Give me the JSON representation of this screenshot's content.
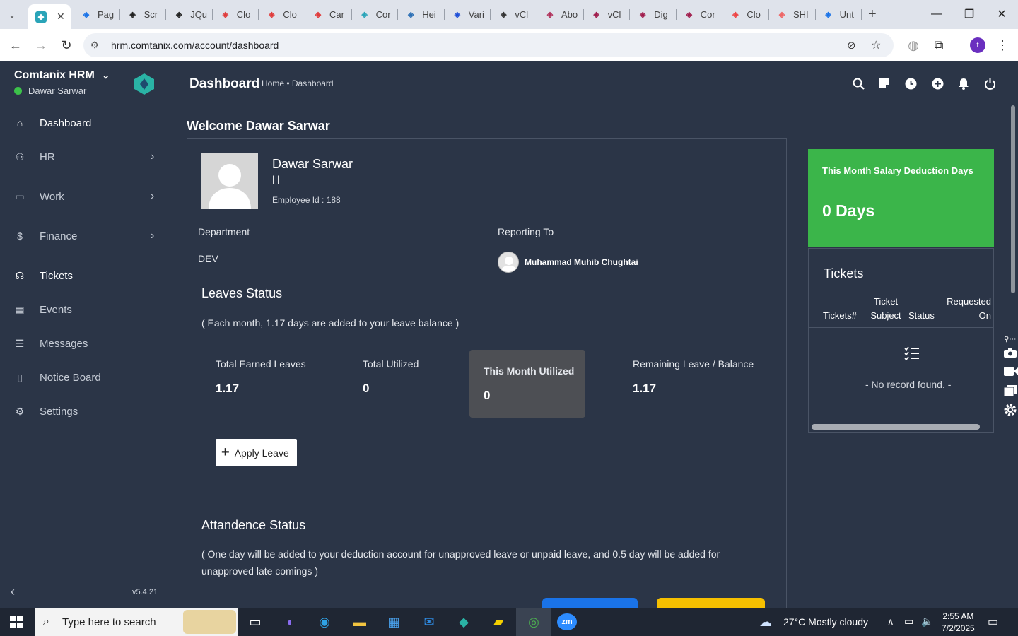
{
  "browser": {
    "tabs": [
      {
        "title": "Pag",
        "icon": "wave-icon",
        "color": "#1a73e8"
      },
      {
        "title": "Scr",
        "icon": "gear-globe-icon",
        "color": "#222"
      },
      {
        "title": "JQu",
        "icon": "target-icon",
        "color": "#222"
      },
      {
        "title": "Clo",
        "icon": "tag-icon",
        "color": "#e03b3b"
      },
      {
        "title": "Clo",
        "icon": "tag-icon",
        "color": "#e03b3b"
      },
      {
        "title": "Car",
        "icon": "tag-icon",
        "color": "#e03b3b"
      },
      {
        "title": "Cor",
        "icon": "hex-icon",
        "color": "#2aa4b8"
      },
      {
        "title": "Hei",
        "icon": "scale-icon",
        "color": "#2c6fb5"
      },
      {
        "title": "Vari",
        "icon": "x-icon",
        "color": "#1d4ed8"
      },
      {
        "title": "vCl",
        "icon": "check-icon",
        "color": "#333"
      },
      {
        "title": "Abo",
        "icon": "dots-icon",
        "color": "#b0305a"
      },
      {
        "title": "vCl",
        "icon": "v-icon",
        "color": "#a01c4c"
      },
      {
        "title": "Dig",
        "icon": "v-icon",
        "color": "#a01c4c"
      },
      {
        "title": "Cor",
        "icon": "v-icon",
        "color": "#a01c4c"
      },
      {
        "title": "Clo",
        "icon": "slash-icon",
        "color": "#e44"
      },
      {
        "title": "SHI",
        "icon": "ring-icon",
        "color": "#e66"
      },
      {
        "title": "Unt",
        "icon": "doc-icon",
        "color": "#1a73e8"
      }
    ],
    "url": "hrm.comtanix.com/account/dashboard"
  },
  "sidebar": {
    "brand": "Comtanix HRM",
    "user": "Dawar Sarwar",
    "items": [
      {
        "label": "Dashboard",
        "icon": "home-icon",
        "active": true
      },
      {
        "label": "HR",
        "icon": "users-icon",
        "sub": true
      },
      {
        "label": "Work",
        "icon": "briefcase-icon",
        "sub": true
      },
      {
        "label": "Finance",
        "icon": "dollar-icon",
        "sub": true
      },
      {
        "label": "Tickets",
        "icon": "headset-icon",
        "active": true
      },
      {
        "label": "Events",
        "icon": "calendar-icon"
      },
      {
        "label": "Messages",
        "icon": "message-icon"
      },
      {
        "label": "Notice Board",
        "icon": "clipboard-icon"
      },
      {
        "label": "Settings",
        "icon": "gear-icon"
      }
    ],
    "version": "v5.4.21"
  },
  "header": {
    "title": "Dashboard",
    "breadcrumb": "Home • Dashboard"
  },
  "welcome": "Welcome Dawar Sarwar",
  "profile": {
    "name": "Dawar Sarwar",
    "bars": "| |",
    "employee_id": "Employee Id : 188",
    "department_label": "Department",
    "department": "DEV",
    "reporting_label": "Reporting To",
    "reporting_to": "Muhammad Muhib Chughtai"
  },
  "leaves": {
    "title": "Leaves Status",
    "note": "( Each month, 1.17 days are added to your leave balance )",
    "stats": [
      {
        "label": "Total Earned Leaves",
        "value": "1.17"
      },
      {
        "label": "Total Utilized",
        "value": "0"
      },
      {
        "label": "This Month Utilized",
        "value": "0"
      },
      {
        "label": "Remaining Leave / Balance",
        "value": "1.17"
      }
    ],
    "apply_label": "Apply Leave"
  },
  "attendance": {
    "title": "Attandence Status",
    "note": "( One day will be added to your deduction account for unapproved leave or unpaid leave, and 0.5 day will be added for unapproved late comings )"
  },
  "salary_card": {
    "title": "This Month Salary Deduction Days",
    "value": "0 Days",
    "color": "#3bb54a"
  },
  "tickets": {
    "title": "Tickets",
    "columns": [
      "Tickets#",
      "Ticket Subject",
      "Status",
      "Requested On"
    ],
    "empty": "- No record found. -"
  },
  "taskbar": {
    "search_placeholder": "Type here to search",
    "weather": "27°C  Mostly cloudy",
    "time": "2:55 AM",
    "date": "7/2/2025"
  }
}
